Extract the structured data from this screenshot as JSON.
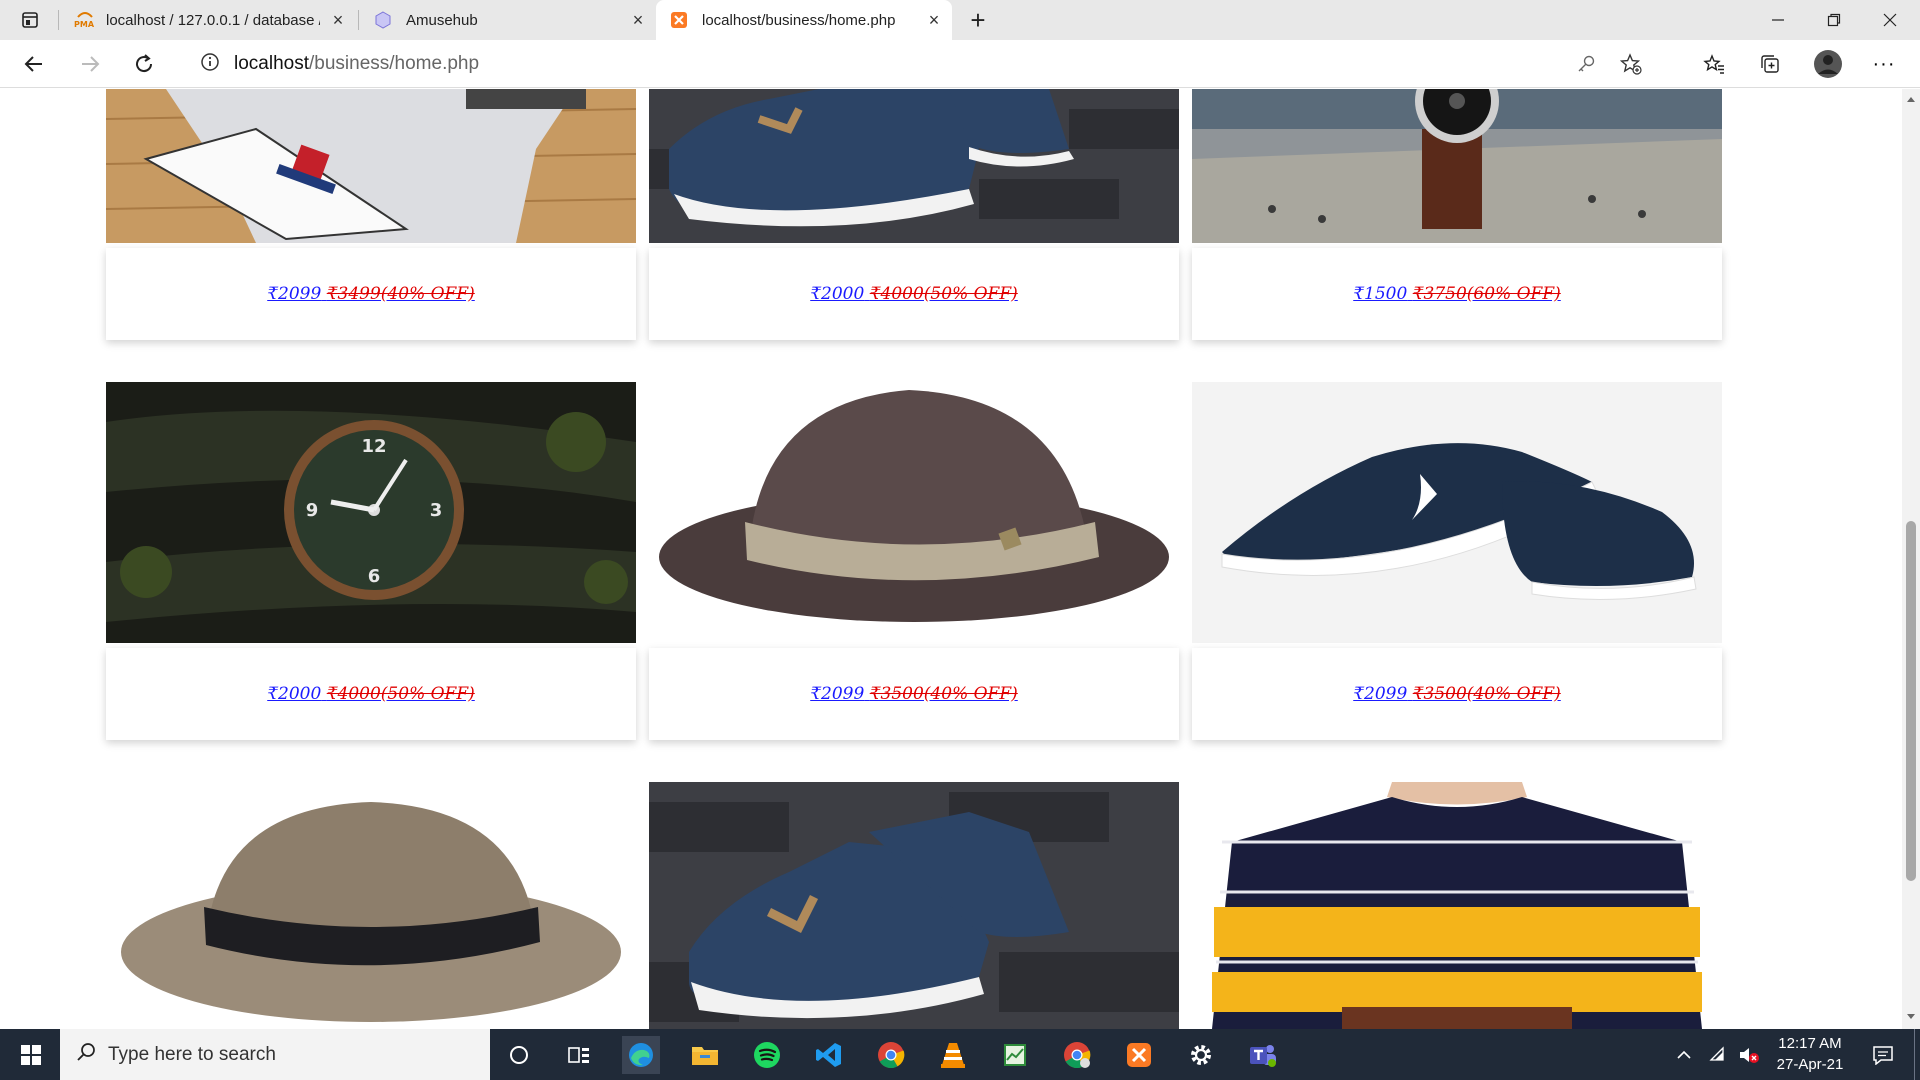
{
  "browser": {
    "tabs": [
      {
        "title": "localhost / 127.0.0.1 / database /",
        "icon": "phpmyadmin-icon"
      },
      {
        "title": "Amusehub",
        "icon": "globe-icon"
      },
      {
        "title": "localhost/business/home.php",
        "icon": "xampp-icon"
      }
    ],
    "new_tab": "+",
    "url_host": "localhost",
    "url_path": "/business/home.php"
  },
  "products": [
    {
      "price": "₹2099",
      "old_price": "₹3499(40% OFF)",
      "image": "white t-shirt on wood"
    },
    {
      "price": "₹2000",
      "old_price": "₹4000(50% OFF)",
      "image": "navy sneakers"
    },
    {
      "price": "₹1500",
      "old_price": "₹3750(60% OFF)",
      "image": "pilot watch"
    },
    {
      "price": "₹2000",
      "old_price": "₹4000(50% OFF)",
      "image": "green dial watch"
    },
    {
      "price": "₹2099",
      "old_price": "₹3500(40% OFF)",
      "image": "brown fedora"
    },
    {
      "price": "₹2099",
      "old_price": "₹3500(40% OFF)",
      "image": "navy running shoes"
    },
    {
      "image": "beige fedora"
    },
    {
      "image": "navy sneakers"
    },
    {
      "image": "striped t-shirt"
    }
  ],
  "taskbar": {
    "search_placeholder": "Type here to search",
    "time": "12:17 AM",
    "date": "27-Apr-21"
  }
}
